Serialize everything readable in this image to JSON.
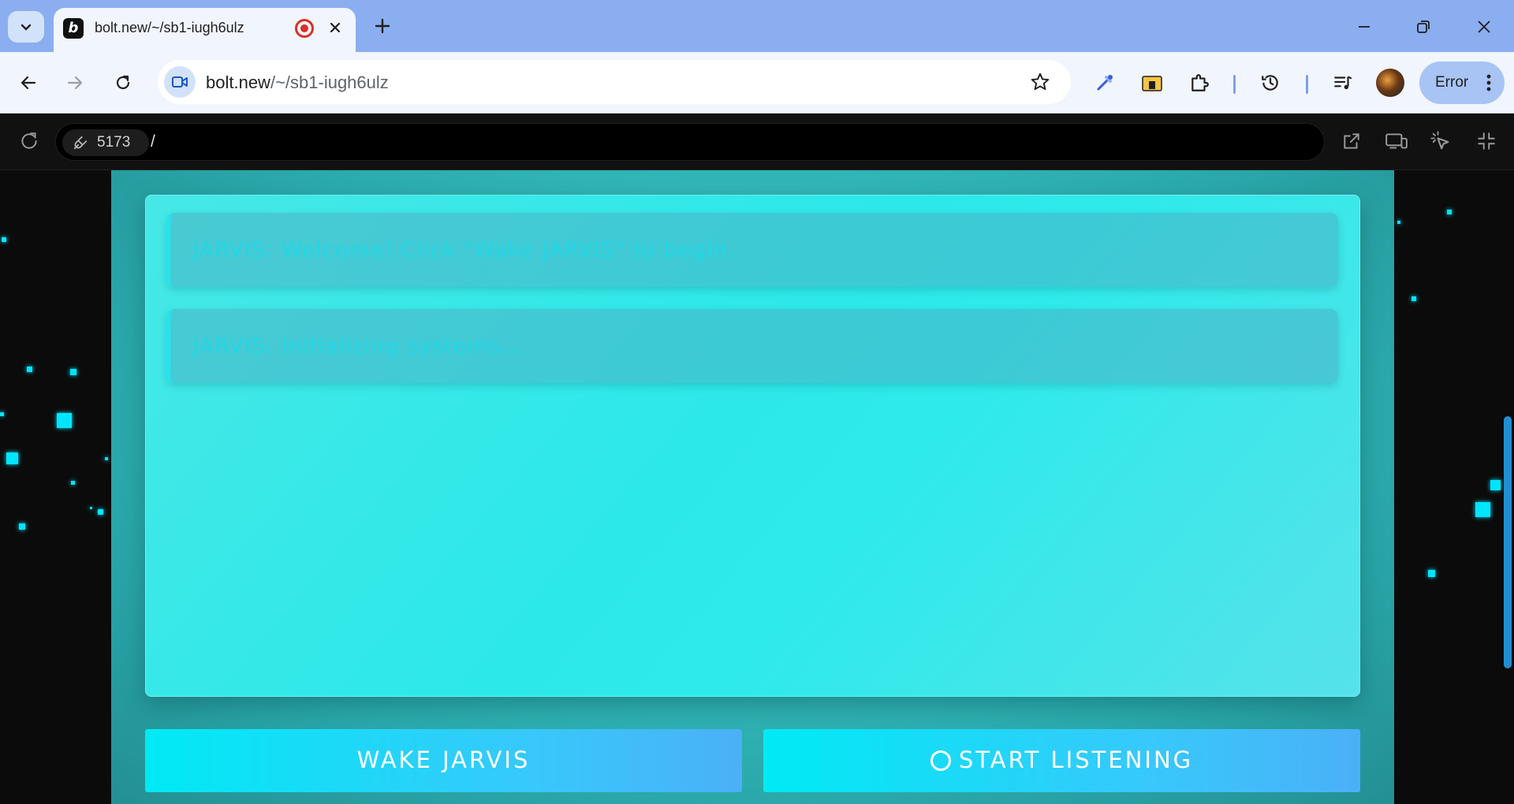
{
  "browser": {
    "tab": {
      "title": "bolt.new/~/sb1-iugh6ulz",
      "favicon_letter": "b"
    },
    "address": {
      "host": "bolt.new",
      "path": "/~/sb1-iugh6ulz"
    },
    "profile_button_label": "Error"
  },
  "preview": {
    "port": "5173",
    "path": "/"
  },
  "app": {
    "messages": [
      {
        "text": "JARVIS: Welcome! Click \"Wake JARVIS\" to begin."
      },
      {
        "text": "JARVIS: Initializing systems..."
      }
    ],
    "wake_button_label": "WAKE JARVIS",
    "listen_button_label": "START LISTENING"
  },
  "colors": {
    "accent": "#00e5ff",
    "tabstrip": "#8aaef0"
  }
}
